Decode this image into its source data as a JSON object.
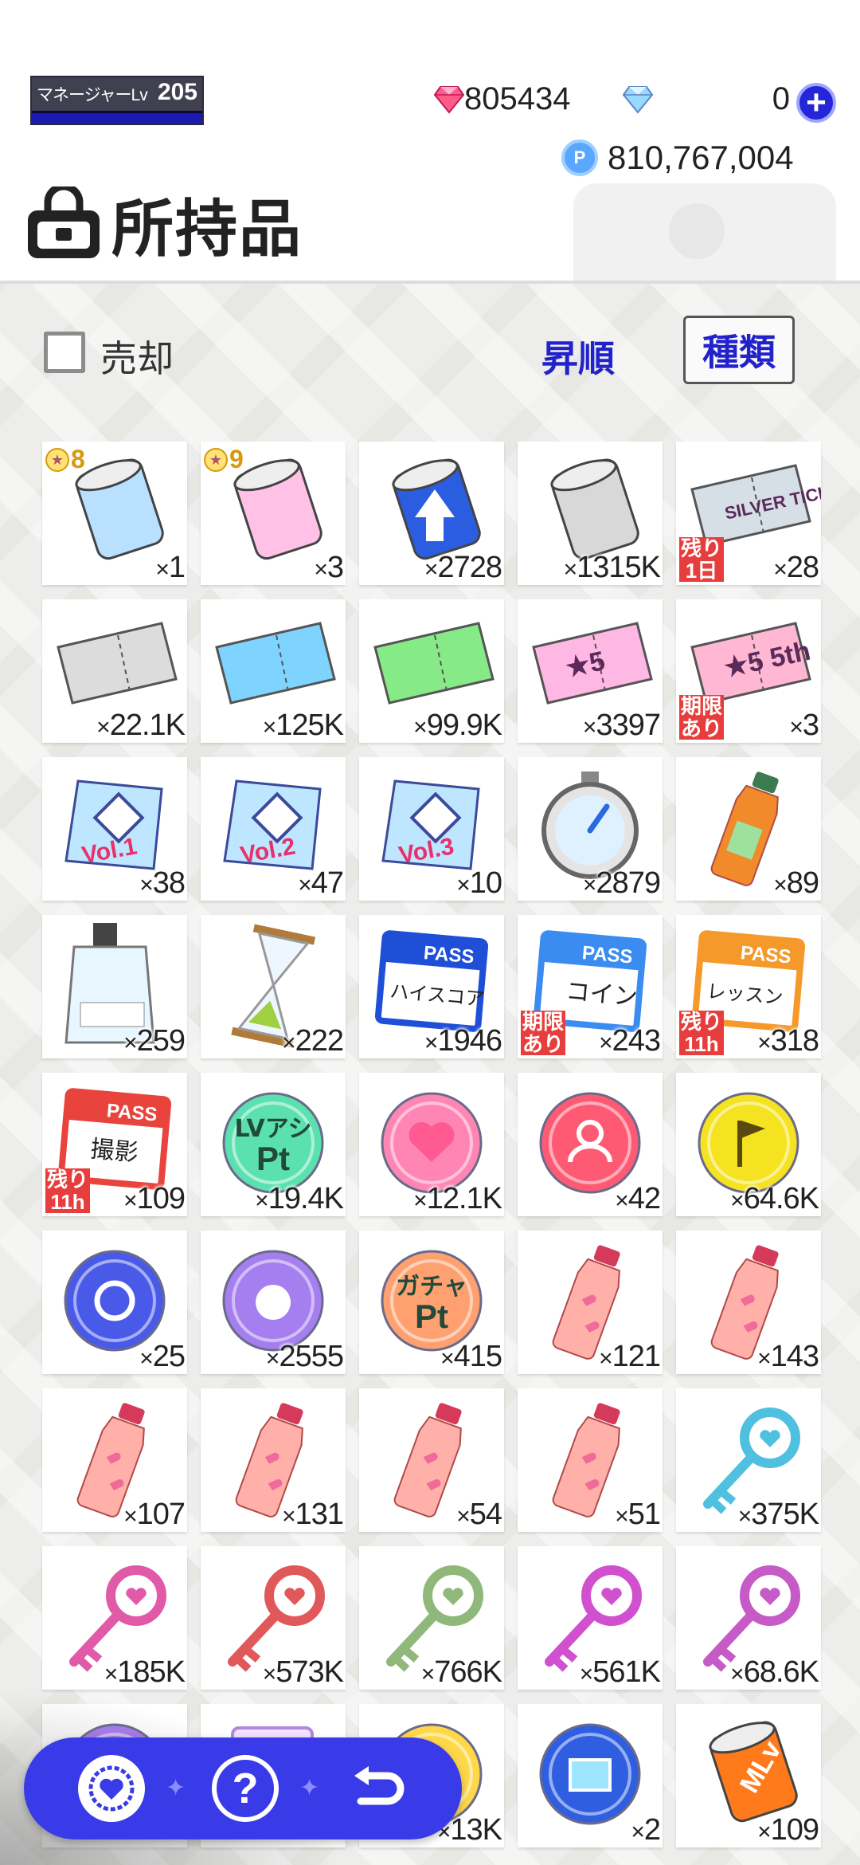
{
  "header": {
    "manager_level_label": "マネージャーLv",
    "manager_level": "205",
    "paid_gems": "805434",
    "free_gems": "0",
    "coins": "810,767,004",
    "coin_icon_label": "P",
    "title": "所持品"
  },
  "controls": {
    "sell_label": "売却",
    "sort_label": "昇順",
    "kind_label": "種類"
  },
  "items": [
    {
      "icon": "film-roll-rainbow-icon",
      "qty": "1",
      "star": "8"
    },
    {
      "icon": "film-roll-star-icon",
      "qty": "3",
      "star": "9"
    },
    {
      "icon": "film-roll-blue-up-icon",
      "qty": "2728"
    },
    {
      "icon": "film-roll-silver-icon",
      "qty": "1315K"
    },
    {
      "icon": "silver-ticket-icon",
      "qty": "28",
      "tag": "残り1日",
      "art_text": "SILVER TICKET"
    },
    {
      "icon": "ticket-strip-silver-icon",
      "qty": "22.1K"
    },
    {
      "icon": "ticket-strip-blue-icon",
      "qty": "125K"
    },
    {
      "icon": "ticket-strip-green-icon",
      "qty": "99.9K"
    },
    {
      "icon": "ticket-strip-star5-icon",
      "qty": "3397",
      "art_text": "★5"
    },
    {
      "icon": "ticket-star5-5th-icon",
      "qty": "3",
      "tag": "期限あり",
      "art_text": "★5 5th"
    },
    {
      "icon": "pack-vol1-icon",
      "qty": "38",
      "art_text": "Vol.1"
    },
    {
      "icon": "pack-vol2-icon",
      "qty": "47",
      "art_text": "Vol.2"
    },
    {
      "icon": "pack-vol3-icon",
      "qty": "10",
      "art_text": "Vol.3"
    },
    {
      "icon": "stopwatch-icon",
      "qty": "2879"
    },
    {
      "icon": "green-drink-bottle-icon",
      "qty": "89"
    },
    {
      "icon": "jelly-pouch-icon",
      "qty": "259"
    },
    {
      "icon": "hourglass-icon",
      "qty": "222"
    },
    {
      "icon": "pass-highscore-icon",
      "qty": "1946",
      "art_text": "ハイスコア"
    },
    {
      "icon": "pass-coin-icon",
      "qty": "243",
      "tag": "期限あり",
      "art_text": "コイン"
    },
    {
      "icon": "pass-lesson-icon",
      "qty": "318",
      "tag": "残り11h",
      "art_text": "レッスン"
    },
    {
      "icon": "pass-photo-icon",
      "qty": "109",
      "tag": "残り11h",
      "art_text": "撮影"
    },
    {
      "icon": "lv-assist-pt-icon",
      "qty": "19.4K",
      "art_text": "LVアシ Pt"
    },
    {
      "icon": "heart-medal-icon",
      "qty": "12.1K"
    },
    {
      "icon": "person-medal-icon",
      "qty": "42"
    },
    {
      "icon": "flag-medal-icon",
      "qty": "64.6K"
    },
    {
      "icon": "flower-medal-icon",
      "qty": "25"
    },
    {
      "icon": "bear-medal-icon",
      "qty": "2555"
    },
    {
      "icon": "gacha-pt-icon",
      "qty": "415",
      "art_text": "ガチャ Pt"
    },
    {
      "icon": "pink-drink-bottle-icon",
      "qty": "121"
    },
    {
      "icon": "pink-drink-bottle-icon",
      "qty": "143"
    },
    {
      "icon": "pink-drink-bottle-icon",
      "qty": "107"
    },
    {
      "icon": "pink-drink-bottle-icon",
      "qty": "131"
    },
    {
      "icon": "pink-drink-bottle-icon",
      "qty": "54"
    },
    {
      "icon": "pink-drink-bottle-icon",
      "qty": "51"
    },
    {
      "icon": "blue-key-icon",
      "qty": "375K"
    },
    {
      "icon": "pink-key-icon",
      "qty": "185K"
    },
    {
      "icon": "red-key-icon",
      "qty": "573K"
    },
    {
      "icon": "green-key-icon",
      "qty": "766K"
    },
    {
      "icon": "magenta-key-icon",
      "qty": "561K"
    },
    {
      "icon": "purple-key-icon",
      "qty": "68.6K"
    },
    {
      "icon": "purple-medal-icon",
      "qty": ""
    },
    {
      "icon": "card-icon",
      "qty": ""
    },
    {
      "icon": "gold-medal-icon",
      "qty": "13K"
    },
    {
      "icon": "photo-medal-icon",
      "qty": "2"
    },
    {
      "icon": "mlv-film-roll-icon",
      "qty": "109",
      "art_text": "MLv"
    }
  ],
  "nav": {
    "buttons": [
      "heart-badge-icon",
      "help-icon",
      "back-icon"
    ]
  },
  "colors": {
    "accent": "#3a3be8",
    "level_bar": "#1a1ab0",
    "tag_red": "#e83d3d",
    "sort_text": "#2222cc"
  }
}
